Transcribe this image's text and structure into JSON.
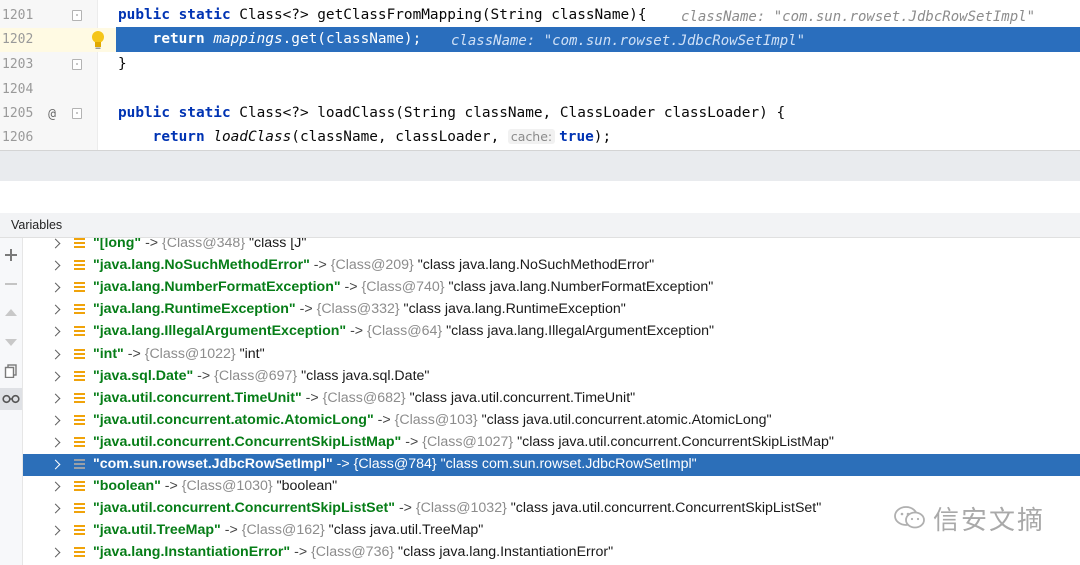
{
  "editor": {
    "lines": [
      {
        "num": "1201",
        "code_kw": "public static ",
        "code_rest": "Class<?> getClassFromMapping(String className){",
        "hint": "className: \"com.sun.rowset.JdbcRowSetImpl\""
      },
      {
        "num": "1202",
        "code_kw": "return ",
        "code_it": "mappings",
        "code_rest": ".get(className);",
        "hint": "className: \"com.sun.rowset.JdbcRowSetImpl\""
      },
      {
        "num": "1203",
        "code_rest": "}"
      },
      {
        "num": "1204"
      },
      {
        "num": "1205",
        "gutter_mark": "@",
        "code_kw": "public static ",
        "code_rest": "Class<?> loadClass(String className, ClassLoader classLoader) {"
      },
      {
        "num": "1206",
        "code_kw": "return ",
        "code_it": "loadClass",
        "code_rest": "(className, classLoader, ",
        "param_hint": "cache:",
        "code_kw2": "true",
        "code_tail": ");"
      }
    ]
  },
  "panel": {
    "title": "Variables"
  },
  "toolbar": {
    "icons": [
      "plus-icon",
      "minus-icon",
      "up-arrow-icon",
      "down-arrow-icon",
      "copy-icon",
      "glasses-icon"
    ]
  },
  "variables": [
    {
      "key": "\"[long\"",
      "arrow": " -> ",
      "cls": "{Class@348}",
      "val": " \"class [J\""
    },
    {
      "key": "\"java.lang.NoSuchMethodError\"",
      "arrow": " -> ",
      "cls": "{Class@209}",
      "val": " \"class java.lang.NoSuchMethodError\""
    },
    {
      "key": "\"java.lang.NumberFormatException\"",
      "arrow": " -> ",
      "cls": "{Class@740}",
      "val": " \"class java.lang.NumberFormatException\""
    },
    {
      "key": "\"java.lang.RuntimeException\"",
      "arrow": " -> ",
      "cls": "{Class@332}",
      "val": " \"class java.lang.RuntimeException\""
    },
    {
      "key": "\"java.lang.IllegalArgumentException\"",
      "arrow": " -> ",
      "cls": "{Class@64}",
      "val": " \"class java.lang.IllegalArgumentException\""
    },
    {
      "key": "\"int\"",
      "arrow": " -> ",
      "cls": "{Class@1022}",
      "val": " \"int\""
    },
    {
      "key": "\"java.sql.Date\"",
      "arrow": " -> ",
      "cls": "{Class@697}",
      "val": " \"class java.sql.Date\""
    },
    {
      "key": "\"java.util.concurrent.TimeUnit\"",
      "arrow": " -> ",
      "cls": "{Class@682}",
      "val": " \"class java.util.concurrent.TimeUnit\""
    },
    {
      "key": "\"java.util.concurrent.atomic.AtomicLong\"",
      "arrow": " -> ",
      "cls": "{Class@103}",
      "val": " \"class java.util.concurrent.atomic.AtomicLong\""
    },
    {
      "key": "\"java.util.concurrent.ConcurrentSkipListMap\"",
      "arrow": " -> ",
      "cls": "{Class@1027}",
      "val": " \"class java.util.concurrent.ConcurrentSkipListMap\""
    },
    {
      "key": "\"com.sun.rowset.JdbcRowSetImpl\"",
      "arrow": " -> ",
      "cls": "{Class@784}",
      "val": " \"class com.sun.rowset.JdbcRowSetImpl\""
    },
    {
      "key": "\"boolean\"",
      "arrow": " -> ",
      "cls": "{Class@1030}",
      "val": " \"boolean\""
    },
    {
      "key": "\"java.util.concurrent.ConcurrentSkipListSet\"",
      "arrow": " -> ",
      "cls": "{Class@1032}",
      "val": " \"class java.util.concurrent.ConcurrentSkipListSet\""
    },
    {
      "key": "\"java.util.TreeMap\"",
      "arrow": " -> ",
      "cls": "{Class@162}",
      "val": " \"class java.util.TreeMap\""
    },
    {
      "key": "\"java.lang.InstantiationError\"",
      "arrow": " -> ",
      "cls": "{Class@736}",
      "val": " \"class java.lang.InstantiationError\""
    }
  ],
  "selected_variable_index": 10,
  "watermark": {
    "text": "信安文摘",
    "icon": "wechat-icon"
  },
  "colors": {
    "keyword": "#0033b3",
    "key_string": "#067d17",
    "selection": "#2c6fb9",
    "field_icon": "#f0a30a"
  }
}
